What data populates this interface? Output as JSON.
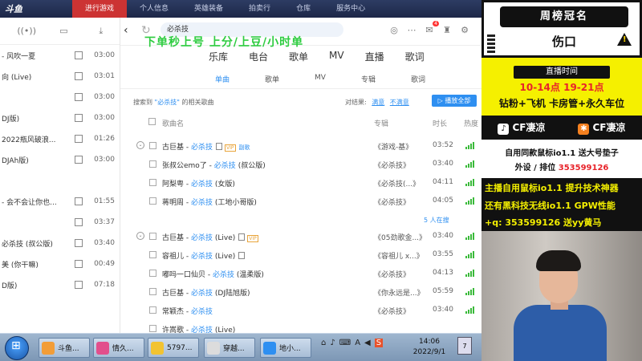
{
  "game_bar": {
    "logo": "斗鱼",
    "tabs": [
      {
        "label": "进行游戏",
        "active": true
      },
      {
        "label": "个人信息",
        "active": false
      },
      {
        "label": "英雄装备",
        "active": false
      },
      {
        "label": "拍卖行",
        "active": false
      },
      {
        "label": "仓库",
        "active": false
      },
      {
        "label": "服务中心",
        "active": false
      }
    ]
  },
  "music": {
    "search_query": "必杀技",
    "overlay_text": "下单秒上号   上分/上豆/小时单",
    "notification_count": "4",
    "categories": [
      "乐库",
      "电台",
      "歌单",
      "MV",
      "直播",
      "歌词"
    ],
    "subtabs": [
      {
        "label": "单曲",
        "active": true
      },
      {
        "label": "歌单",
        "active": false
      },
      {
        "label": "MV",
        "active": false
      },
      {
        "label": "专辑",
        "active": false
      },
      {
        "label": "歌词",
        "active": false
      }
    ],
    "search_info_prefix": "搜索到",
    "search_info_query": "\"必杀技\"",
    "search_info_suffix": "的相关歌曲",
    "compare_label": "对结果:",
    "compare_good": "满意",
    "compare_bad": "不满意",
    "play_all": "▷ 播放全部",
    "columns": {
      "title": "歌曲名",
      "album": "专辑",
      "duration": "时长",
      "heat": "热度"
    },
    "rows": [
      {
        "artist": "古巨基",
        "song": "必杀技",
        "extra": "",
        "vip": true,
        "mv": true,
        "lyric": "副歌",
        "album": "《游戏-基》",
        "duration": "03:52",
        "expand": true
      },
      {
        "artist": "张叔公emo了",
        "song": "必杀技",
        "extra": "(叔公版)",
        "vip": false,
        "mv": false,
        "lyric": "",
        "album": "《必杀技》",
        "duration": "03:40",
        "expand": false
      },
      {
        "artist": "阿梨粤",
        "song": "必杀技",
        "extra": "(女版)",
        "vip": false,
        "mv": false,
        "lyric": "",
        "album": "《必杀技(...》",
        "duration": "04:11",
        "expand": false
      },
      {
        "artist": "蒋明周",
        "song": "必杀技",
        "extra": "(工地小哥版)",
        "vip": false,
        "mv": false,
        "lyric": "",
        "album": "《必杀技》",
        "duration": "04:05",
        "expand": false
      },
      {
        "artist": "古巨基",
        "song": "必杀技",
        "extra": "(Live)",
        "vip": true,
        "mv": true,
        "lyric": "",
        "album": "《05劲歌金...》",
        "duration": "03:40",
        "expand": true
      },
      {
        "artist": "容祖儿",
        "song": "必杀技",
        "extra": "(Live)",
        "vip": false,
        "mv": true,
        "lyric": "",
        "album": "《容祖儿 x...》",
        "duration": "03:55",
        "expand": false
      },
      {
        "artist": "嘟吗一口仙贝",
        "song": "必杀技",
        "extra": "(温柔版)",
        "vip": false,
        "mv": false,
        "lyric": "",
        "album": "《必杀技》",
        "duration": "04:13",
        "expand": false
      },
      {
        "artist": "古巨基",
        "song": "必杀技",
        "extra": "(DJ陆旭版)",
        "vip": false,
        "mv": false,
        "lyric": "",
        "album": "《你永远是...》",
        "duration": "05:59",
        "expand": false
      },
      {
        "artist": "常颖杰",
        "song": "必杀技",
        "extra": "",
        "vip": false,
        "mv": false,
        "lyric": "",
        "album": "《必杀技》",
        "duration": "03:40",
        "expand": false
      },
      {
        "artist": "许嵩歌",
        "song": "必杀技",
        "extra": "(Live)",
        "vip": false,
        "mv": false,
        "lyric": "",
        "album": "",
        "duration": "",
        "expand": false
      }
    ],
    "listening": "5 人在搜"
  },
  "playlist": {
    "items": [
      {
        "title": "- 风吹一夏",
        "vip": false,
        "duration": "03:00"
      },
      {
        "title": "向 (Live)",
        "vip": true,
        "duration": "03:01"
      },
      {
        "title": "",
        "vip": true,
        "duration": "03:00"
      },
      {
        "title": "DJ版)",
        "vip": false,
        "duration": "03:00"
      },
      {
        "title": "2022瓶风破浪...",
        "vip": false,
        "duration": "01:26"
      },
      {
        "title": "DJAh版)",
        "vip": false,
        "duration": "03:00"
      },
      {
        "title": "",
        "vip": false,
        "duration": ""
      },
      {
        "title": "- 会不会让你也...",
        "vip": false,
        "duration": "01:55"
      },
      {
        "title": "",
        "vip": true,
        "duration": "03:37"
      },
      {
        "title": "必杀技 (叔公版)",
        "vip": false,
        "duration": "03:40"
      },
      {
        "title": "美 (你干嘛)",
        "vip": false,
        "duration": "00:49"
      },
      {
        "title": "D版)",
        "vip": false,
        "duration": "07:18"
      }
    ]
  },
  "stream": {
    "weekly_title": "周榜冠名",
    "weekly_name": "伤口",
    "schedule_title": "直播时间",
    "schedule_time": "10-14点   19-21点",
    "schedule_perks": "钻粉+飞机 卡房管+永久车位",
    "douyin_name": "CF凄凉",
    "kuaishou_name": "CF凄凉",
    "mouse_line": "自用同款鼠标io1.1  送大号垫子",
    "contact_label": "外设 / 排位",
    "contact_qq": "353599126",
    "ad_line1": "主播自用鼠标io1.1    提升技术神器",
    "ad_line2": "还有黑科技无线io1.1 GPW性能",
    "ad_line3": "+q: 353599126    送yy黄马"
  },
  "taskbar": {
    "items": [
      {
        "label": "斗鱼...",
        "color": "#f29d38"
      },
      {
        "label": "情久...",
        "color": "#e24f8c"
      },
      {
        "label": "5797...",
        "color": "#f2c331"
      },
      {
        "label": "穿越...",
        "color": "#dcdcdc"
      },
      {
        "label": "地小...",
        "color": "#2e8ff1"
      }
    ],
    "time": "14:06",
    "date": "2022/9/1"
  }
}
